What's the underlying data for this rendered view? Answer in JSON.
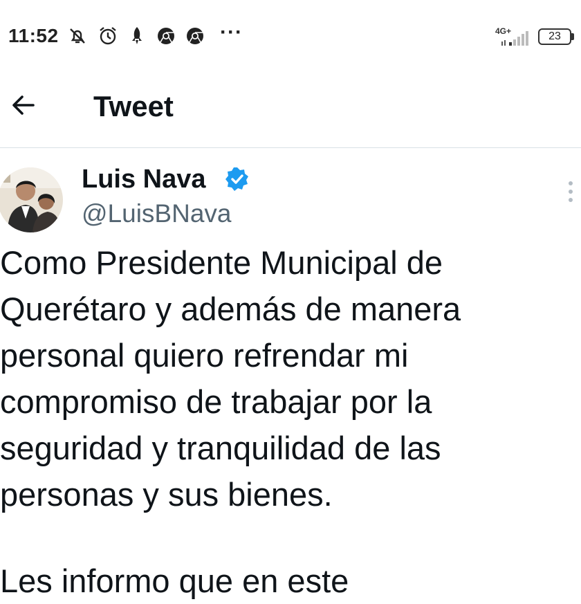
{
  "status_bar": {
    "time": "11:52",
    "network": "4G+",
    "battery": "23",
    "more": "···",
    "icons": [
      "mute-icon",
      "alarm-icon",
      "rocket-icon",
      "chrome-icon",
      "chrome-icon",
      "signal-icon",
      "battery-icon"
    ]
  },
  "header": {
    "title": "Tweet",
    "back_icon": "arrow-left-icon"
  },
  "tweet": {
    "author_name": "Luis Nava",
    "handle": "@LuisBNava",
    "verified": true,
    "text": "Como Presidente Municipal de\nQuerétaro y además de manera\npersonal quiero refrendar mi\ncompromiso de trabajar por la\nseguridad y tranquilidad de las\npersonas y sus bienes.",
    "text_continued": "Les informo que en este"
  },
  "colors": {
    "verified_blue": "#1d9bf0",
    "text_primary": "#0f1419",
    "text_secondary": "#536471",
    "divider": "#d9e1e6"
  }
}
